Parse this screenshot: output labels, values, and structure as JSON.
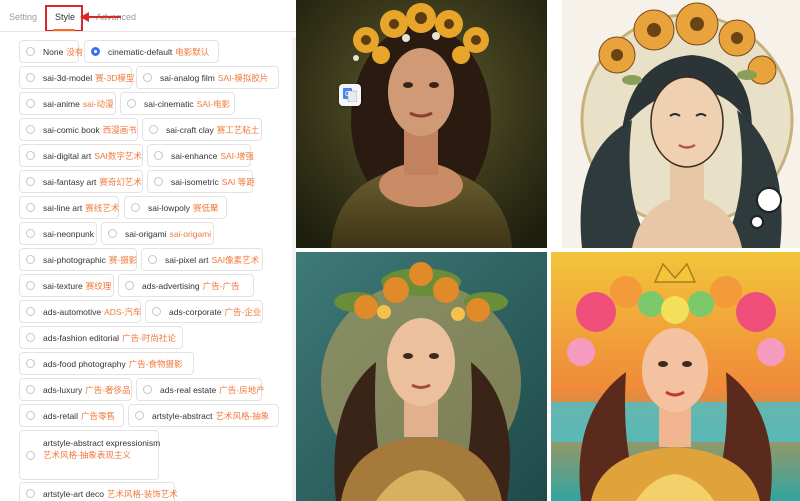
{
  "tabs": [
    {
      "label": "Setting",
      "active": false
    },
    {
      "label": "Style",
      "active": true
    },
    {
      "label": "Advanced",
      "active": false
    }
  ],
  "options": [
    {
      "en": "None",
      "zh": "没有",
      "checked": false
    },
    {
      "en": "cinematic-default",
      "zh": "电影默认",
      "checked": true
    },
    {
      "en": "sai-3d-model",
      "zh": "赛-3D模型",
      "checked": false
    },
    {
      "en": "sai-analog film",
      "zh": "SAI-模拟胶片",
      "checked": false
    },
    {
      "en": "sai-anime",
      "zh": "sai-动漫",
      "checked": false
    },
    {
      "en": "sai-cinematic",
      "zh": "SAI-电影",
      "checked": false
    },
    {
      "en": "sai-comic book",
      "zh": "西漫画书",
      "checked": false
    },
    {
      "en": "sai-craft clay",
      "zh": "赛工艺粘土",
      "checked": false
    },
    {
      "en": "sai-digital art",
      "zh": "SAI数字艺术",
      "checked": false
    },
    {
      "en": "sai-enhance",
      "zh": "SAI-增强",
      "checked": false
    },
    {
      "en": "sai-fantasy art",
      "zh": "赛奇幻艺术",
      "checked": false
    },
    {
      "en": "sai-isometric",
      "zh": "SAI 等距",
      "checked": false
    },
    {
      "en": "sai-line art",
      "zh": "赛线艺术",
      "checked": false
    },
    {
      "en": "sai-lowpoly",
      "zh": "赛低聚",
      "checked": false
    },
    {
      "en": "sai-neonpunk",
      "zh": "",
      "checked": false
    },
    {
      "en": "sai-origami",
      "zh": "sai-origami",
      "checked": false
    },
    {
      "en": "sai-photographic",
      "zh": "赛-摄影",
      "checked": false
    },
    {
      "en": "sai-pixel art",
      "zh": "SAI像素艺术",
      "checked": false
    },
    {
      "en": "sai-texture",
      "zh": "赛纹理",
      "checked": false
    },
    {
      "en": "ads-advertising",
      "zh": "广告-广告",
      "checked": false
    },
    {
      "en": "ads-automotive",
      "zh": "ADS-汽车",
      "checked": false
    },
    {
      "en": "ads-corporate",
      "zh": "广告-企业",
      "checked": false
    },
    {
      "en": "ads-fashion editorial",
      "zh": "广告-时尚社论",
      "checked": false
    },
    {
      "en": "ads-food photography",
      "zh": "广告-食物摄影",
      "checked": false
    },
    {
      "en": "ads-luxury",
      "zh": "广告-奢侈品",
      "checked": false
    },
    {
      "en": "ads-real estate",
      "zh": "广告-房地产",
      "checked": false
    },
    {
      "en": "ads-retail",
      "zh": "广告零售",
      "checked": false
    },
    {
      "en": "artstyle-abstract",
      "zh": "艺术风格-抽象",
      "checked": false
    },
    {
      "en": "artstyle-abstract expressionism",
      "zh": "艺术风格-抽象表现主义",
      "checked": false
    },
    {
      "en": "artstyle-art deco",
      "zh": "艺术风格-装饰艺术",
      "checked": false
    }
  ],
  "colors": {
    "accent": "#3b6ff5",
    "zh_text": "#f07a3c",
    "highlight_box": "#d62a2a",
    "tab_underline": "#ff6a1a"
  },
  "images": [
    {
      "name": "photo-portrait-sunflower-crown"
    },
    {
      "name": "illustration-art-nouveau-portrait"
    },
    {
      "name": "painting-leaf-crown-portrait"
    },
    {
      "name": "painting-colorful-flower-crown-portrait"
    }
  ],
  "icons": {
    "translate": "google-translate-icon",
    "annotation_arrow": "red-arrow-icon"
  }
}
